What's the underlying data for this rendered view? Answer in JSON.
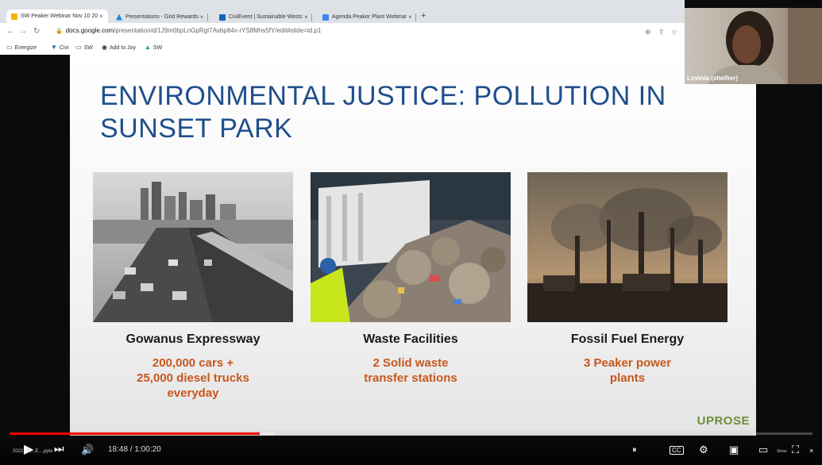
{
  "browser": {
    "tabs": [
      {
        "title": "SW Peaker Webinar Nov 10 20",
        "favicon_color": "#f4b400",
        "active": true
      },
      {
        "title": "Presentations - Grid Rewards",
        "favicon_color": "#1e88e5"
      },
      {
        "title": "CiviEvent | Sustainable Westc",
        "favicon_color": "#1565c0"
      },
      {
        "title": "Agenda Peaker Plant Webinar",
        "favicon_color": "#4285f4"
      }
    ],
    "close_glyph": "×",
    "newtab_glyph": "+",
    "url_host": "docs.google.com",
    "url_path": "/presentation/d/1J9m0bpLnGpRgI7Avbp84x-rYS8Mhs5fY/edit#slide=id.p1",
    "bookmarks": [
      {
        "label": "Energize",
        "icon": "folder-icon"
      },
      {
        "label": "Civi",
        "icon": "civi-icon"
      },
      {
        "label": "SW",
        "icon": "folder-icon"
      },
      {
        "label": "Add to Joy",
        "icon": "joy-icon"
      },
      {
        "label": "SW",
        "icon": "drive-icon"
      }
    ]
  },
  "slide": {
    "title": "ENVIRONMENTAL JUSTICE: POLLUTION IN SUNSET PARK",
    "columns": [
      {
        "caption": "Gowanus Expressway",
        "stat": "200,000 cars +\n25,000 diesel trucks\neveryday"
      },
      {
        "caption": "Waste Facilities",
        "stat": "2 Solid waste\ntransfer stations"
      },
      {
        "caption": "Fossil Fuel Energy",
        "stat": "3 Peaker power\nplants"
      }
    ],
    "logo_text": "UPROSE"
  },
  "webcam": {
    "name": "Lovinia (she/her)"
  },
  "player": {
    "time": "18:48 / 1:00:20",
    "progress_fraction": 0.3117,
    "buffered_fraction": 0.33,
    "next_file": "2022_06...E....pptx",
    "show_label": "Show",
    "cc_label": "CC",
    "colors": {
      "progress": "#ff0000",
      "title": "#1f4e8c",
      "stat": "#c8571c"
    }
  }
}
